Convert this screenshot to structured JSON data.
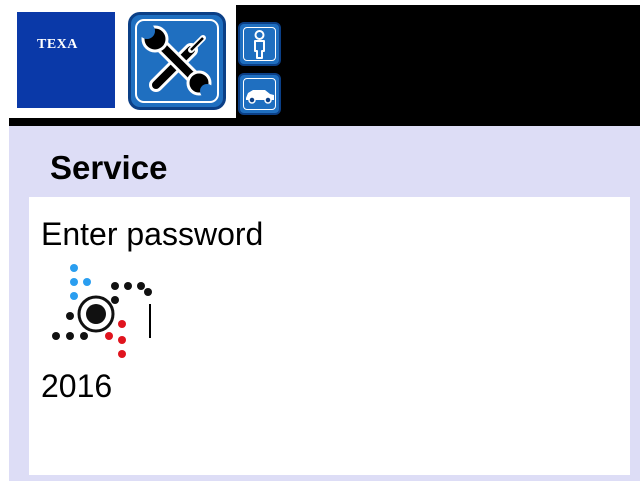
{
  "header": {
    "logo_text": "TEXA",
    "service_icon": "wrench-screwdriver-icon",
    "side_buttons": [
      "user-icon",
      "car-icon"
    ]
  },
  "page": {
    "title": "Service",
    "prompt": "Enter password",
    "password_value": "2016",
    "loading_icon": "texa-dots-icon"
  },
  "colors": {
    "brand_blue": "#0a39a8",
    "button_blue": "#1f6fc0",
    "background_lavender": "#ddddf6",
    "header_black": "#000000",
    "icon_dot_blue": "#2a9ef0",
    "icon_dot_red": "#e0141e",
    "icon_dot_black": "#111111"
  }
}
